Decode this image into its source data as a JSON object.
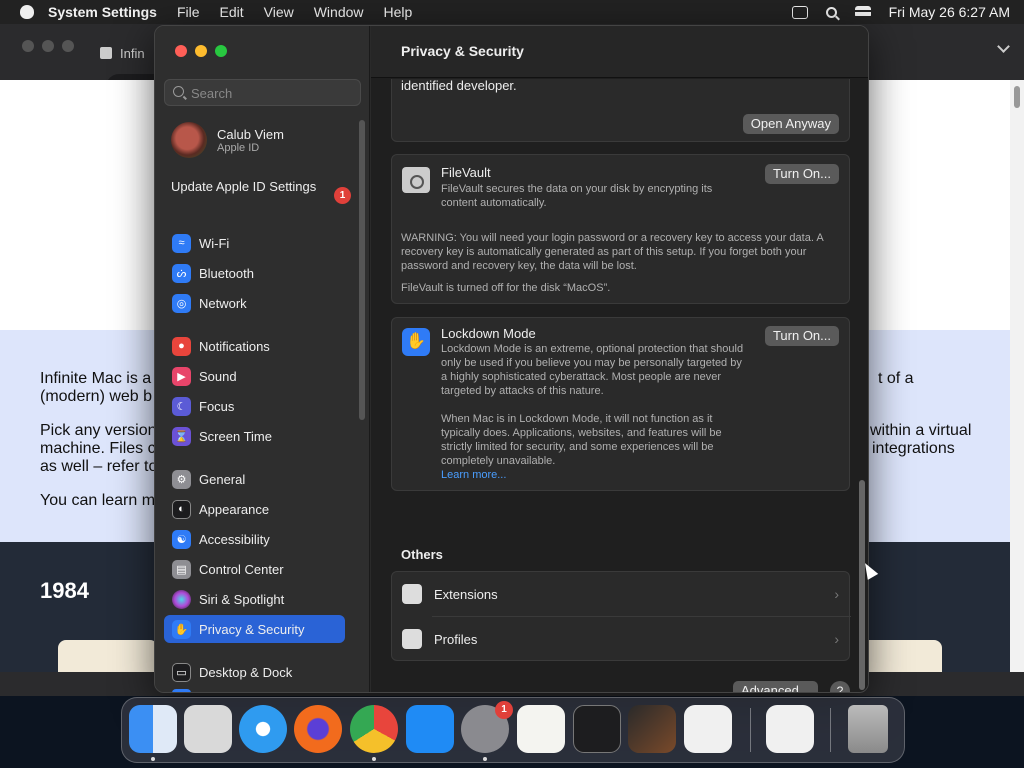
{
  "menubar": {
    "app_name": "System Settings",
    "items": [
      "File",
      "Edit",
      "View",
      "Window",
      "Help"
    ],
    "clock": "Fri May 26  6:27 AM"
  },
  "browser": {
    "tab_title": "Infin",
    "url": "in",
    "intro_lines": [
      "Infinite Mac is a",
      "(modern) web b",
      "Pick any version",
      "machine. Files c",
      "as well – refer to",
      "You can learn m"
    ],
    "intro_right": [
      "t of a",
      "within a virtual",
      "integrations"
    ],
    "year": "1984"
  },
  "sidebar": {
    "search_placeholder": "Search",
    "account": {
      "name": "Calub Viem",
      "sub": "Apple ID"
    },
    "update": {
      "label": "Update Apple ID Settings",
      "badge": "1"
    },
    "items": [
      {
        "label": "Wi-Fi",
        "icon": "wifi-icon",
        "color": "#2f7bf6"
      },
      {
        "label": "Bluetooth",
        "icon": "bluetooth-icon",
        "color": "#2f7bf6"
      },
      {
        "label": "Network",
        "icon": "globe-icon",
        "color": "#2f7bf6"
      },
      {
        "label": "Notifications",
        "icon": "bell-icon",
        "color": "#e8453c"
      },
      {
        "label": "Sound",
        "icon": "speaker-icon",
        "color": "#e8456a"
      },
      {
        "label": "Focus",
        "icon": "moon-icon",
        "color": "#5b5bd6"
      },
      {
        "label": "Screen Time",
        "icon": "hourglass-icon",
        "color": "#6b52d6"
      },
      {
        "label": "General",
        "icon": "gear-icon",
        "color": "#8e8e93"
      },
      {
        "label": "Appearance",
        "icon": "appearance-icon",
        "color": "#1c1c1e"
      },
      {
        "label": "Accessibility",
        "icon": "accessibility-icon",
        "color": "#2f7bf6"
      },
      {
        "label": "Control Center",
        "icon": "control-center-icon",
        "color": "#8e8e93"
      },
      {
        "label": "Siri & Spotlight",
        "icon": "siri-icon",
        "color": "#b04ad8"
      },
      {
        "label": "Privacy & Security",
        "icon": "hand-icon",
        "color": "#2f7bf6"
      },
      {
        "label": "Desktop & Dock",
        "icon": "dock-icon",
        "color": "#1c1c1e"
      }
    ]
  },
  "content": {
    "title": "Privacy & Security",
    "top_text": "identified developer.",
    "open_anyway": "Open Anyway",
    "filevault": {
      "title": "FileVault",
      "desc": "FileVault secures the data on your disk by encrypting its content automatically.",
      "button": "Turn On...",
      "warning": "WARNING: You will need your login password or a recovery key to access your data. A recovery key is automatically generated as part of this setup. If you forget both your password and recovery key, the data will be lost.",
      "status": "FileVault is turned off for the disk “MacOS”."
    },
    "lockdown": {
      "title": "Lockdown Mode",
      "desc": "Lockdown Mode is an extreme, optional protection that should only be used if you believe you may be personally targeted by a highly sophisticated cyberattack. Most people are never targeted by attacks of this nature.",
      "desc2": "When Mac is in Lockdown Mode, it will not function as it typically does. Applications, websites, and features will be strictly limited for security, and some experiences will be completely unavailable.",
      "link": "Learn more...",
      "button": "Turn On..."
    },
    "others": {
      "title": "Others",
      "rows": [
        {
          "label": "Extensions",
          "icon": "extensions-icon"
        },
        {
          "label": "Profiles",
          "icon": "profiles-icon"
        }
      ]
    },
    "advanced": "Advanced...",
    "help": "?"
  },
  "dock": {
    "apps": [
      {
        "name": "Finder",
        "color": "#3b8ff3"
      },
      {
        "name": "Launchpad",
        "color": "#d9d9d9"
      },
      {
        "name": "Safari",
        "color": "#2f9bf0"
      },
      {
        "name": "Firefox",
        "color": "#f26b1d"
      },
      {
        "name": "Chrome",
        "color": "#e8e8e8"
      },
      {
        "name": "App Store",
        "color": "#1f8bf5"
      },
      {
        "name": "System Settings",
        "color": "#8a8a8f",
        "badge": "1"
      },
      {
        "name": "TextEdit",
        "color": "#f4f4f0"
      },
      {
        "name": "Terminal",
        "color": "#1d1d1f"
      },
      {
        "name": "GarageBand",
        "color": "#7a4a2a"
      },
      {
        "name": "Visual Studio Code",
        "color": "#f0f0f0"
      },
      {
        "name": "Visual Studio",
        "color": "#f0f0f0"
      },
      {
        "name": "Trash",
        "color": "#9a9a9a"
      }
    ]
  }
}
